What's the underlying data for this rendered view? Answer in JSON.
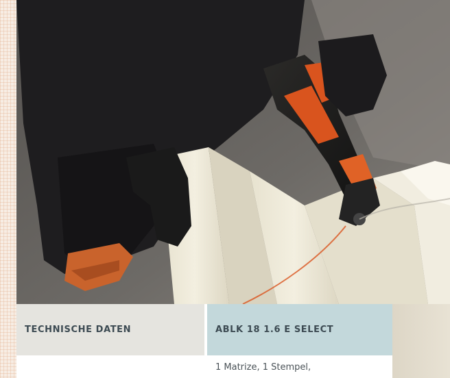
{
  "table": {
    "header_col1": "TECHNISCHE DATEN",
    "header_col2": "ABLK 18 1.6 E SELECT",
    "row1_col1": "",
    "row1_col2": "1 Matrize, 1 Stempel,"
  },
  "colors": {
    "header_col1_bg": "#e5e4df",
    "header_col2_bg": "#c3d8db",
    "header_text": "#3c4a52",
    "tool_orange": "#d9541e"
  }
}
